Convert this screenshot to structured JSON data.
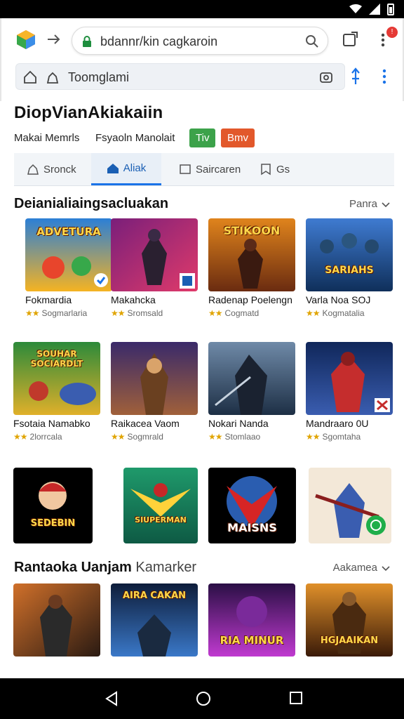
{
  "browser": {
    "url_text": "bdannr/kin cagkaroin",
    "sub_bar_text": "Toomglami",
    "notify_count": "!"
  },
  "page": {
    "title": "DiopVianAkiakaiin",
    "meta_left": "Makai Memrls",
    "meta_right": "Fsyaoln Manolait",
    "badge_green": "Tiv",
    "badge_orange": "Bmv"
  },
  "tabs": [
    {
      "label": "Sronck",
      "icon": "person-outline-icon"
    },
    {
      "label": "Aliak",
      "icon": "home-icon"
    },
    {
      "label": "Saircaren",
      "icon": "window-icon"
    },
    {
      "label": "Gs",
      "icon": "bookmark-icon"
    }
  ],
  "section1": {
    "title": "Deianialiaingsacluakan",
    "more": "Panra"
  },
  "section2": {
    "title_bold": "Rantaoka Uanjam",
    "title_light": "Kamarker",
    "more": "Aakamea"
  },
  "cards_row1": [
    {
      "title": "Fokmardia",
      "rating": "Sogmarlaria",
      "thumb_text": "ADVETURA",
      "colors": [
        "#2b7fd6",
        "#f5b322"
      ]
    },
    {
      "title": "Makahcka",
      "rating": "Sromsald",
      "thumb_text": "",
      "colors": [
        "#7a1f7a",
        "#e03a6a"
      ]
    },
    {
      "title": "Radenap Poelengn",
      "rating": "Cogmatd",
      "thumb_text": "STIKOON",
      "colors": [
        "#6a2b10",
        "#e0841c"
      ]
    },
    {
      "title": "Varla Noa SOJ",
      "rating": "Kogmatalia",
      "thumb_text": "SARIAHS",
      "colors": [
        "#0f2f5a",
        "#3f7bd1"
      ]
    }
  ],
  "cards_row2": [
    {
      "title": "Fsotaia Namabko",
      "rating": "2lorrcala",
      "thumb_text": "SOUHAR SOCIARDLT",
      "colors": [
        "#2c8a3a",
        "#e0b02a"
      ]
    },
    {
      "title": "Raikacea Vaom",
      "rating": "Sogmrald",
      "thumb_text": "",
      "colors": [
        "#3a2a6a",
        "#a0603a"
      ]
    },
    {
      "title": "Nokari Nanda",
      "rating": "Stomlaao",
      "thumb_text": "",
      "colors": [
        "#1d2f45",
        "#6f8aa8"
      ]
    },
    {
      "title": "Mandraaro 0U",
      "rating": "Sgomtaha",
      "thumb_text": "",
      "colors": [
        "#10275a",
        "#c52d2d"
      ]
    }
  ],
  "cards_row3": [
    {
      "thumb_text": "SEDEBIN",
      "colors": [
        "#000000",
        "#c62828"
      ]
    },
    {
      "thumb_text": "SIUPERMAN",
      "colors": [
        "#1f9a6b",
        "#ffd23a"
      ]
    },
    {
      "thumb_text": "MAISNS",
      "colors": [
        "#000000",
        "#d62525"
      ]
    },
    {
      "thumb_text": "",
      "colors": [
        "#f3e8d8",
        "#3a5db0"
      ]
    }
  ],
  "cards_row4": [
    {
      "thumb_text": "",
      "colors": [
        "#2a1a12",
        "#d0702a"
      ]
    },
    {
      "thumb_text": "AIRA CAKAN",
      "colors": [
        "#0e1d3a",
        "#3a78c8"
      ]
    },
    {
      "thumb_text": "RIA MINUR",
      "colors": [
        "#2a0f45",
        "#c03ad0"
      ]
    },
    {
      "thumb_text": "HGJAAIKAN",
      "colors": [
        "#3a1a08",
        "#e0902a"
      ]
    }
  ]
}
